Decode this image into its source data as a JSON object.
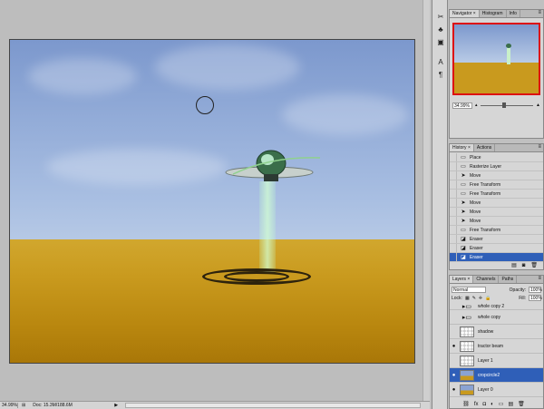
{
  "status": {
    "zoom": "34.99%",
    "doc": "Doc: 15.3M/188.6M"
  },
  "navigator": {
    "tabs": [
      "Navigator ×",
      "Histogram",
      "Info"
    ],
    "zoom": "34.99%"
  },
  "history": {
    "tabs": [
      "History ×",
      "Actions"
    ],
    "items": [
      {
        "label": "Place",
        "icon": "doc-icon"
      },
      {
        "label": "Rasterize Layer",
        "icon": "doc-icon"
      },
      {
        "label": "Move",
        "icon": "move-icon"
      },
      {
        "label": "Free Transform",
        "icon": "doc-icon"
      },
      {
        "label": "Free Transform",
        "icon": "doc-icon"
      },
      {
        "label": "Move",
        "icon": "move-icon"
      },
      {
        "label": "Move",
        "icon": "move-icon"
      },
      {
        "label": "Move",
        "icon": "move-icon"
      },
      {
        "label": "Free Transform",
        "icon": "doc-icon"
      },
      {
        "label": "Eraser",
        "icon": "eraser-icon"
      },
      {
        "label": "Eraser",
        "icon": "eraser-icon"
      },
      {
        "label": "Eraser",
        "icon": "eraser-icon",
        "selected": true
      }
    ]
  },
  "layers": {
    "tabs": [
      "Layers ×",
      "Channels",
      "Paths"
    ],
    "blend_mode": "Normal",
    "opacity_label": "Opacity:",
    "opacity": "100%",
    "lock_label": "Lock:",
    "fill_label": "Fill:",
    "fill": "100%",
    "items": [
      {
        "name": "whole copy 2",
        "type": "folder",
        "visible": false
      },
      {
        "name": "whole copy",
        "type": "folder",
        "visible": false
      },
      {
        "name": "shadow",
        "type": "layer",
        "visible": false
      },
      {
        "name": "tractor beam",
        "type": "layer",
        "visible": true
      },
      {
        "name": "Layer 1",
        "type": "layer",
        "visible": false
      },
      {
        "name": "cropcircle2",
        "type": "photo",
        "visible": true,
        "selected": true
      },
      {
        "name": "Layer 0",
        "type": "photo",
        "visible": true
      }
    ]
  },
  "colors": {
    "selection": "#2f5fb8",
    "navigator_frame": "#dd1111"
  }
}
